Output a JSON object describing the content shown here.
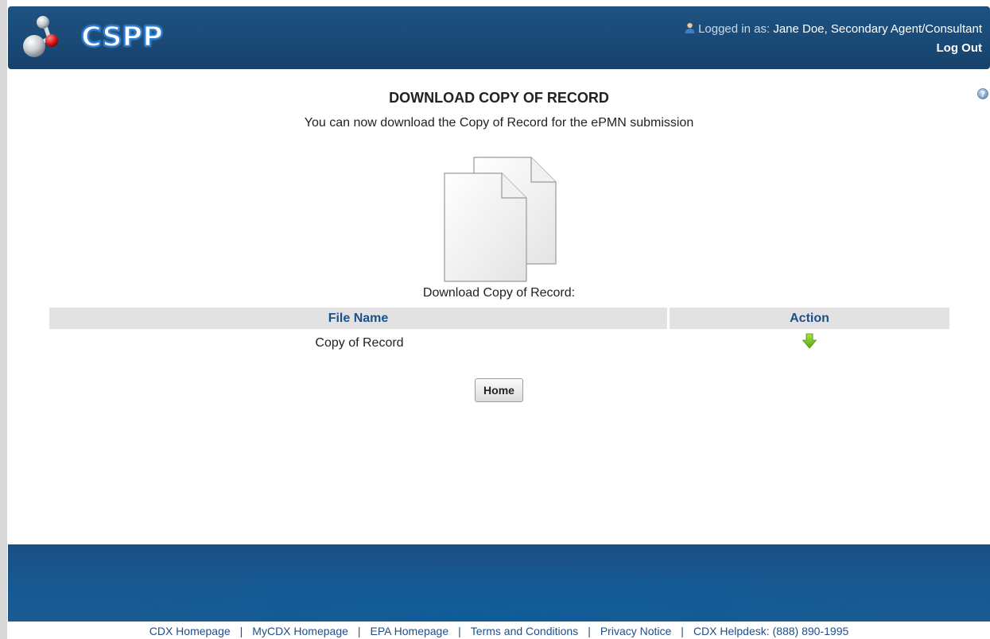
{
  "header": {
    "logo_text": "CSPP",
    "logged_in_prefix": "Logged in as:",
    "user_name": "Jane Doe, Secondary Agent/Consultant",
    "logout_label": "Log Out"
  },
  "main": {
    "title": "DOWNLOAD COPY OF RECORD",
    "subtitle": "You can now download the Copy of Record for the ePMN submission",
    "download_label": "Download Copy of Record:",
    "table": {
      "headers": [
        "File Name",
        "Action"
      ],
      "rows": [
        {
          "file_name": "Copy of Record",
          "action_icon": "download-arrow-icon"
        }
      ]
    },
    "home_button": "Home"
  },
  "footer": {
    "links": [
      "CDX Homepage",
      "MyCDX Homepage",
      "EPA Homepage",
      "Terms and Conditions",
      "Privacy Notice",
      "CDX Helpdesk: (888) 890-1995"
    ],
    "separator": "|"
  },
  "colors": {
    "header_bg": "#1a4a77",
    "link_blue": "#1f4f8a",
    "download_green": "#7cc22a"
  }
}
